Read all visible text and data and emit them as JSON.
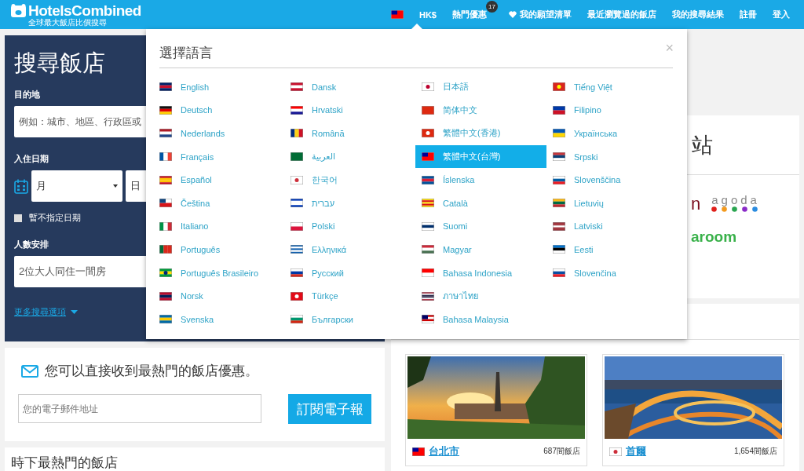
{
  "header": {
    "logo": {
      "name": "HotelsCombined",
      "tagline": "全球最大飯店比價搜尋"
    },
    "nav": [
      {
        "kind": "flag"
      },
      {
        "kind": "text",
        "label": "HK$"
      },
      {
        "kind": "badge",
        "label": "熱門優惠",
        "badge": "17"
      },
      {
        "kind": "heart",
        "label": "我的願望清單"
      },
      {
        "kind": "text",
        "label": "最近瀏覽過的飯店"
      },
      {
        "kind": "text",
        "label": "我的搜尋結果"
      },
      {
        "kind": "text",
        "label": "註冊"
      },
      {
        "kind": "text",
        "label": "登入"
      }
    ]
  },
  "search_panel": {
    "title": "搜尋飯店",
    "destination_label": "目的地",
    "destination_placeholder": "例如：城市、地區、行政區或",
    "checkin_label": "入住日期",
    "month_select": "月",
    "day_select": "日",
    "no_dates": {
      "label": "暫不指定日期",
      "checked": false
    },
    "guests_label": "人數安排",
    "guests_value": "2位大人同住一間房",
    "more_options": "更多搜尋選項"
  },
  "newsletter": {
    "text": "您可以直接收到最熱門的飯店優惠。",
    "email_placeholder": "您的電子郵件地址",
    "button": "訂閱電子報"
  },
  "popular_hotels": {
    "title": "時下最熱門的飯店"
  },
  "partners": {
    "heading_fragment": "站",
    "logo_fragment": "n",
    "agoda": "agoda",
    "aroom": "aroom"
  },
  "cities": [
    {
      "name": "台北市",
      "count": "687間飯店",
      "kind": "picture"
    },
    {
      "name": "首爾",
      "count": "1,654間飯店",
      "kind": "picture"
    }
  ],
  "language_dialog": {
    "title": "選擇語言",
    "close": "×",
    "columns": [
      [
        {
          "label": "English",
          "selected": false
        },
        {
          "label": "Deutsch",
          "selected": false
        },
        {
          "label": "Nederlands",
          "selected": false
        },
        {
          "label": "Français",
          "selected": false
        },
        {
          "label": "Español",
          "selected": false
        },
        {
          "label": "Čeština",
          "selected": false
        },
        {
          "label": "Italiano",
          "selected": false
        },
        {
          "label": "Português",
          "selected": false
        },
        {
          "label": "Português Brasileiro",
          "selected": false
        },
        {
          "label": "Norsk",
          "selected": false
        },
        {
          "label": "Svenska",
          "selected": false
        }
      ],
      [
        {
          "label": "Dansk",
          "selected": false
        },
        {
          "label": "Hrvatski",
          "selected": false
        },
        {
          "label": "Română",
          "selected": false
        },
        {
          "label": "العربية",
          "selected": false
        },
        {
          "label": "한국어",
          "selected": false
        },
        {
          "label": "עברית",
          "selected": false
        },
        {
          "label": "Polski",
          "selected": false
        },
        {
          "label": "Ελληνικά",
          "selected": false
        },
        {
          "label": "Русский",
          "selected": false
        },
        {
          "label": "Türkçe",
          "selected": false
        },
        {
          "label": "Български",
          "selected": false
        }
      ],
      [
        {
          "label": "日本語",
          "selected": false
        },
        {
          "label": "简体中文",
          "selected": false
        },
        {
          "label": "繁體中文(香港)",
          "selected": false
        },
        {
          "label": "繁體中文(台灣)",
          "selected": true
        },
        {
          "label": "Íslenska",
          "selected": false
        },
        {
          "label": "Català",
          "selected": false
        },
        {
          "label": "Suomi",
          "selected": false
        },
        {
          "label": "Magyar",
          "selected": false
        },
        {
          "label": "Bahasa Indonesia",
          "selected": false
        },
        {
          "label": "ภาษาไทย",
          "selected": false
        },
        {
          "label": "Bahasa Malaysia",
          "selected": false
        }
      ],
      [
        {
          "label": "Tiếng Việt",
          "selected": false
        },
        {
          "label": "Filipino",
          "selected": false
        },
        {
          "label": "Українська",
          "selected": false
        },
        {
          "label": "Srpski",
          "selected": false
        },
        {
          "label": "Slovenščina",
          "selected": false
        },
        {
          "label": "Lietuvių",
          "selected": false
        },
        {
          "label": "Latviski",
          "selected": false
        },
        {
          "label": "Eesti",
          "selected": false
        },
        {
          "label": "Slovenčina",
          "selected": false
        }
      ]
    ]
  }
}
